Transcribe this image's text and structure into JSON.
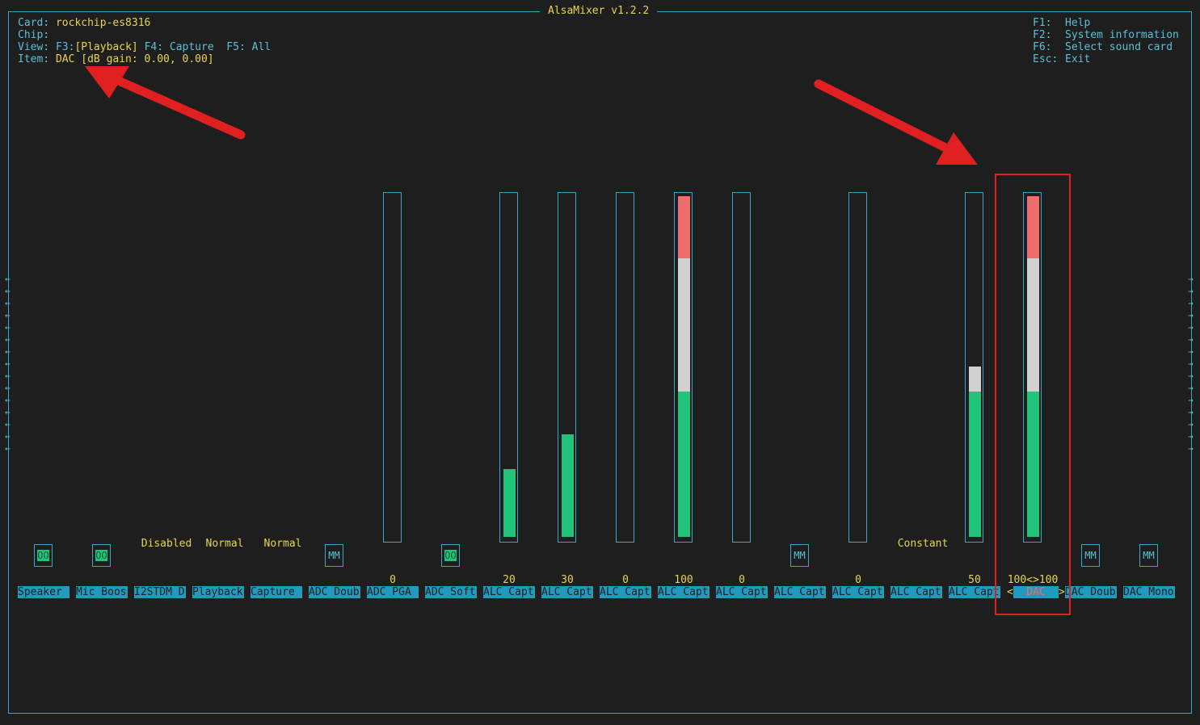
{
  "app": {
    "title": "AlsaMixer v1.2.2"
  },
  "info": {
    "card_label": "Card:",
    "card_value": "rockchip-es8316",
    "chip_label": "Chip:",
    "chip_value": "",
    "view_label": "View:",
    "view_f3": "F3:",
    "view_playback": "[Playback]",
    "view_rest": "F4: Capture  F5: All",
    "item_label": "Item:",
    "item_value": "DAC [dB gain: 0.00, 0.00]"
  },
  "help": [
    {
      "key": "F1:",
      "text": "Help"
    },
    {
      "key": "F2:",
      "text": "System information"
    },
    {
      "key": "F6:",
      "text": "Select sound card"
    },
    {
      "key": "Esc:",
      "text": "Exit"
    }
  ],
  "controls": [
    {
      "label": "Speaker",
      "switch": "OO",
      "switch_on": true
    },
    {
      "label": "Mic Boos",
      "switch": "OO",
      "switch_on": true
    },
    {
      "label": "I2STDM D",
      "enum": "Disabled"
    },
    {
      "label": "Playback",
      "enum": "Normal"
    },
    {
      "label": "Capture ",
      "enum": "Normal"
    },
    {
      "label": "ADC Doub",
      "switch": "MM",
      "switch_on": false
    },
    {
      "label": "ADC PGA ",
      "value": "0",
      "level": 0
    },
    {
      "label": "ADC Soft",
      "switch": "OO",
      "switch_on": true
    },
    {
      "label": "ALC Capt",
      "value": "20",
      "level": 20
    },
    {
      "label": "ALC Capt",
      "value": "30",
      "level": 30
    },
    {
      "label": "ALC Capt",
      "value": "0",
      "level": 0
    },
    {
      "label": "ALC Capt",
      "value": "100",
      "level": 100
    },
    {
      "label": "ALC Capt",
      "value": "0",
      "level": 0
    },
    {
      "label": "ALC Capt",
      "switch": "MM",
      "switch_on": false
    },
    {
      "label": "ALC Capt",
      "value": "0",
      "level": 0
    },
    {
      "label": "ALC Capt",
      "enum": "Constant"
    },
    {
      "label": "ALC Capt",
      "value": "50",
      "level": 50
    },
    {
      "label": "DAC",
      "value": "100<>100",
      "level": 100,
      "selected": true
    },
    {
      "label": "DAC Doub",
      "switch": "MM",
      "switch_on": false
    },
    {
      "label": "DAC Mono",
      "switch": "MM",
      "switch_on": false
    }
  ],
  "scroll": {
    "left_arrow": "←",
    "right_arrow": "→"
  },
  "colors": {
    "accent": "#59c0d9",
    "highlight": "#e8d44d",
    "green": "#21c47a",
    "red": "#f06b6b",
    "annotation": "#e02020"
  }
}
